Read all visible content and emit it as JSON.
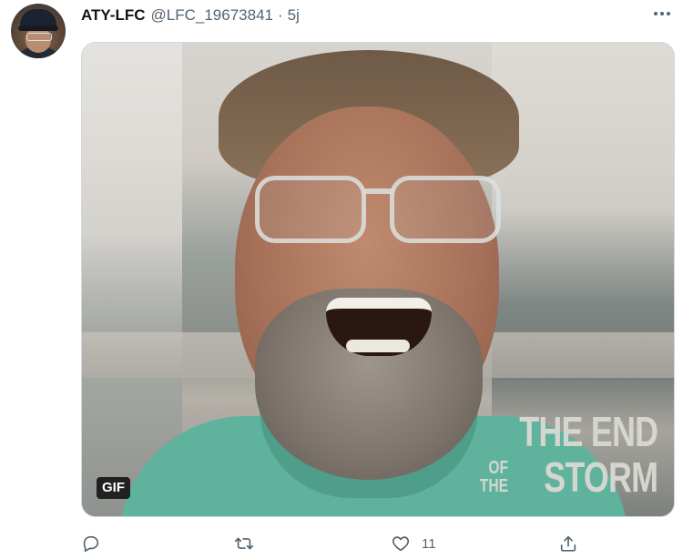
{
  "tweet": {
    "display_name": "ATY-LFC",
    "handle": "@LFC_19673841",
    "separator": "·",
    "time": "5j",
    "media": {
      "badge": "GIF",
      "overlay_line1": "THE END",
      "overlay_of": "OF",
      "overlay_the": "THE",
      "overlay_storm": "STORM"
    },
    "actions": {
      "reply_count": "",
      "retweet_count": "",
      "like_count": "11",
      "share_count": ""
    }
  },
  "icons": {
    "more": "more-horizontal-icon",
    "reply": "reply-icon",
    "retweet": "retweet-icon",
    "like": "heart-icon",
    "share": "share-icon"
  },
  "colors": {
    "secondary_text": "#536471",
    "primary_text": "#0f1419",
    "border": "#cfd9de"
  }
}
